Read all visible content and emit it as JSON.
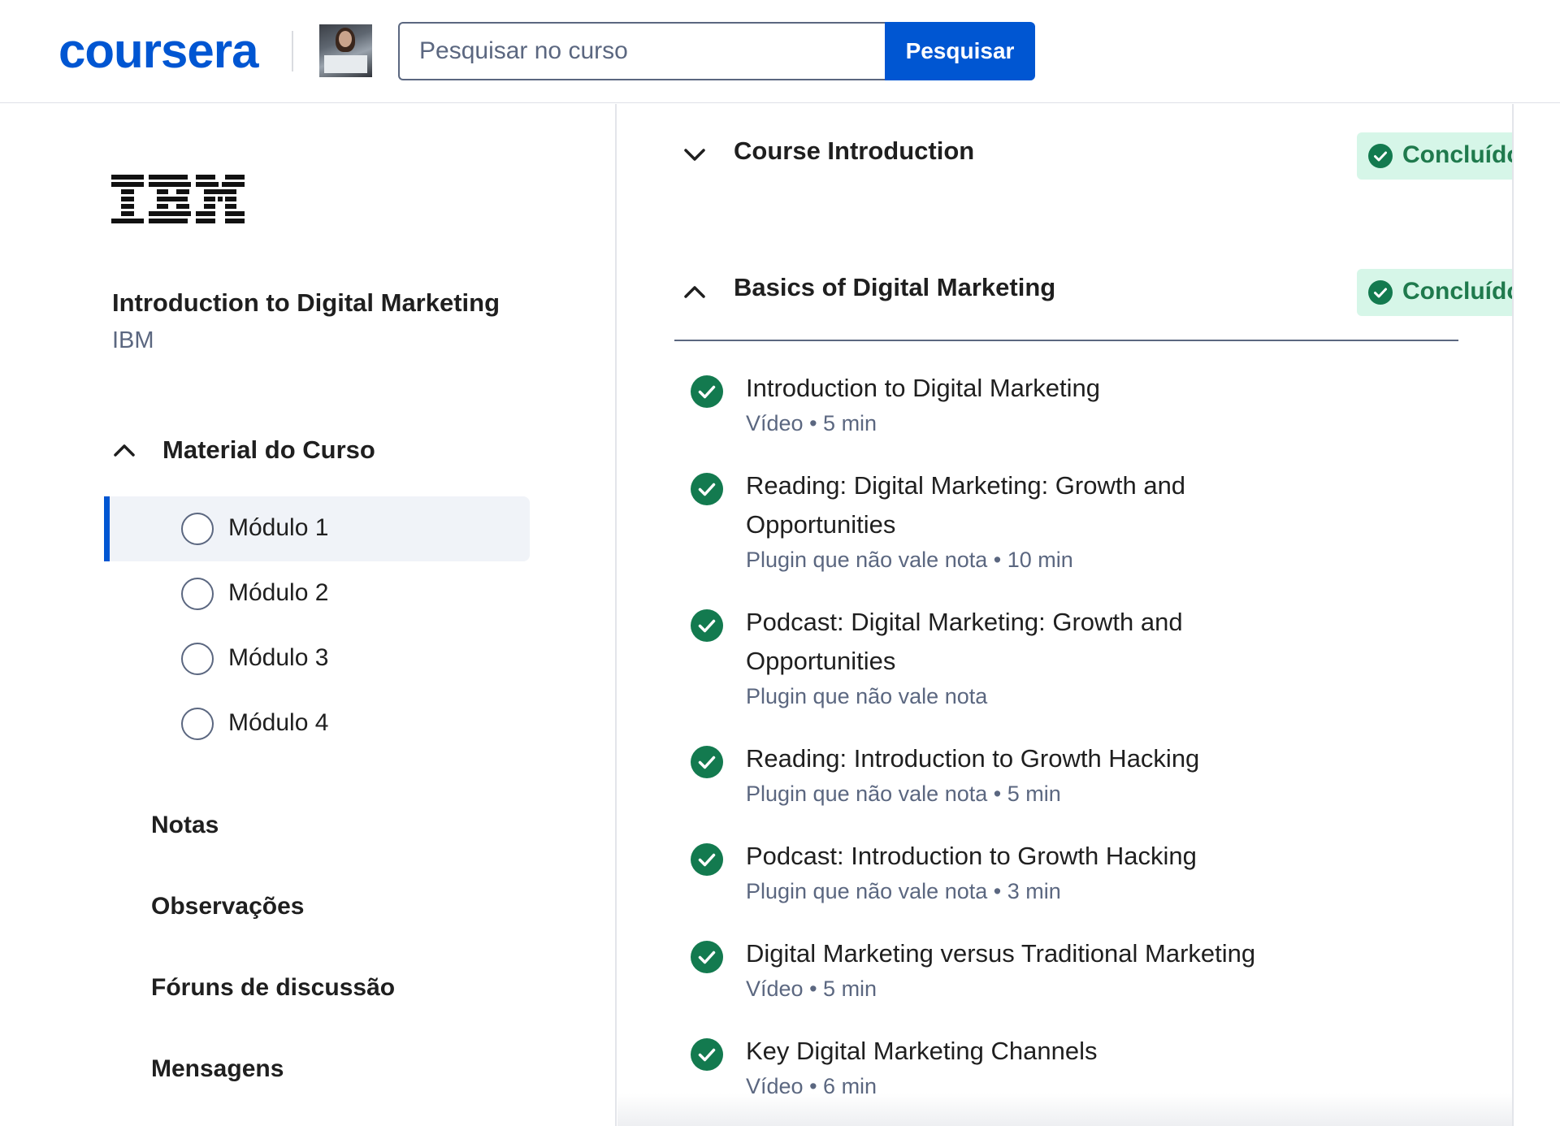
{
  "header": {
    "logo": "coursera",
    "search_placeholder": "Pesquisar no curso",
    "search_button": "Pesquisar"
  },
  "sidebar": {
    "course_title": "Introduction to Digital Marketing",
    "partner": "IBM",
    "material_label": "Material do Curso",
    "modules": [
      {
        "label": "Módulo 1",
        "active": true
      },
      {
        "label": "Módulo 2",
        "active": false
      },
      {
        "label": "Módulo 3",
        "active": false
      },
      {
        "label": "Módulo 4",
        "active": false
      }
    ],
    "links": [
      "Notas",
      "Observações",
      "Fóruns de discussão",
      "Mensagens"
    ]
  },
  "main": {
    "sections": [
      {
        "title": "Course Introduction",
        "status": "Concluído",
        "expanded": false
      },
      {
        "title": "Basics of Digital Marketing",
        "status": "Concluído",
        "expanded": true
      }
    ],
    "items": [
      {
        "title": "Introduction to Digital Marketing",
        "type": "Vídeo",
        "duration": "5 min"
      },
      {
        "title": "Reading: Digital Marketing: Growth and Opportunities",
        "type": "Plugin que não vale nota",
        "duration": "10 min"
      },
      {
        "title": "Podcast: Digital Marketing: Growth and Opportunities",
        "type": "Plugin que não vale nota",
        "duration": ""
      },
      {
        "title": "Reading: Introduction to Growth Hacking",
        "type": "Plugin que não vale nota",
        "duration": "5 min"
      },
      {
        "title": "Podcast: Introduction to Growth Hacking",
        "type": "Plugin que não vale nota",
        "duration": "3 min"
      },
      {
        "title": "Digital Marketing versus Traditional Marketing",
        "type": "Vídeo",
        "duration": "5 min"
      },
      {
        "title": "Key Digital Marketing Channels",
        "type": "Vídeo",
        "duration": "6 min"
      }
    ],
    "separator": "•"
  },
  "colors": {
    "brand": "#0056d2",
    "success_bg": "#d6f6e8",
    "success_text": "#1f7a4d",
    "check_green": "#137a4f",
    "muted": "#5b6780"
  },
  "icons": {
    "collapse": "chevron-up-icon",
    "expand": "chevron-down-icon",
    "complete": "check-circle-icon",
    "module": "radio-circle-icon"
  }
}
